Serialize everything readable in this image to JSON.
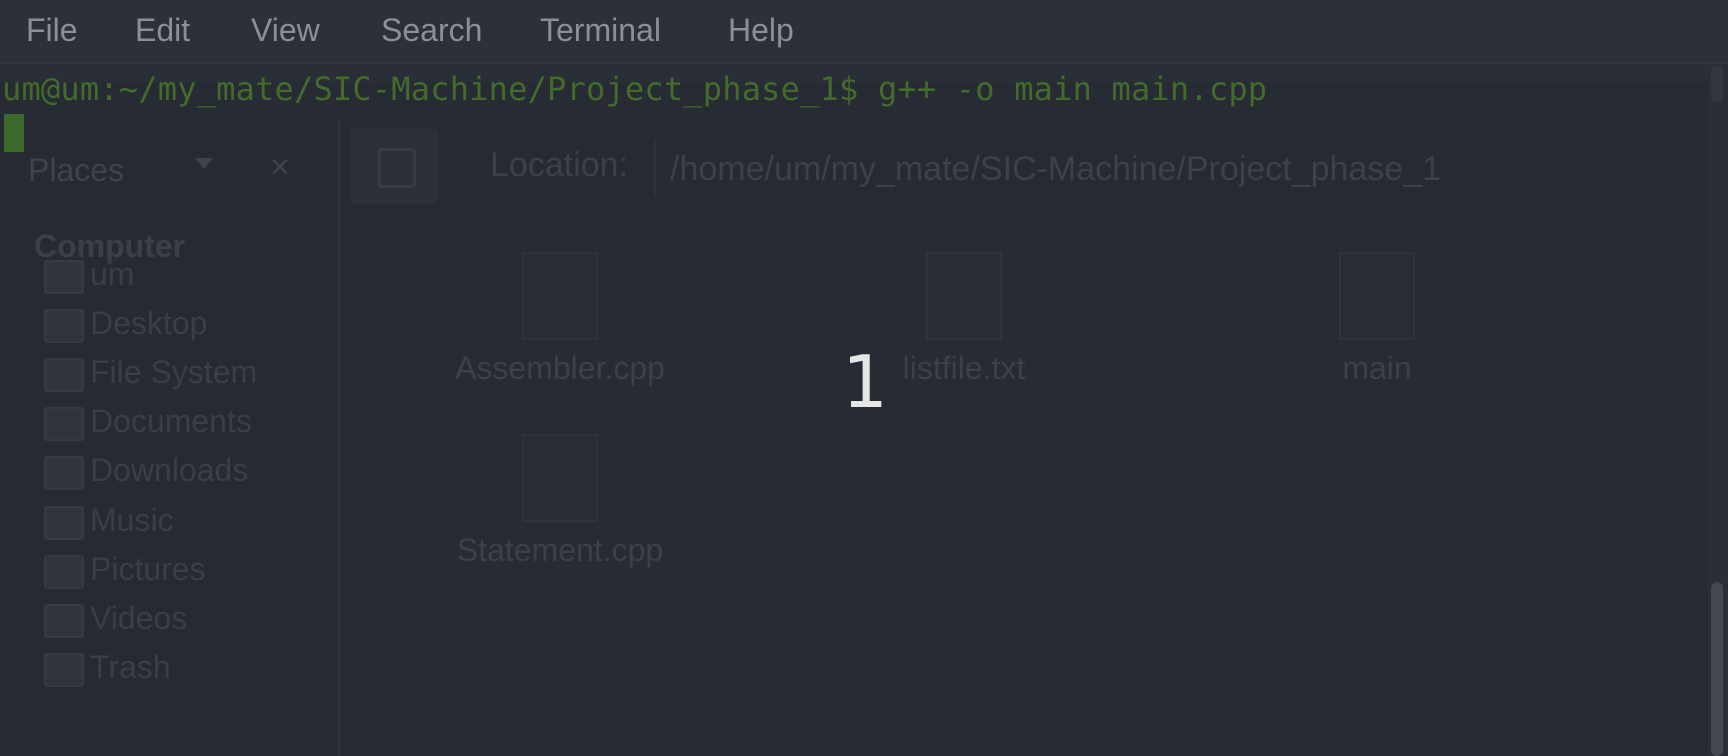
{
  "terminal": {
    "menu": [
      "File",
      "Edit",
      "View",
      "Search",
      "Terminal",
      "Help"
    ],
    "prompt_line": "um@um:~/my_mate/SIC-Machine/Project_phase_1$ g++ -o main main.cpp",
    "colors": {
      "prompt": "#426b2c",
      "background": "#272b33",
      "menu_text": "#8a8f98"
    }
  },
  "file_manager": {
    "places_label": "Places",
    "location_label": "Location:",
    "location_value": "/home/um/my_mate/SIC-Machine/Project_phase_1",
    "sidebar_heading": "Computer",
    "sidebar_items": [
      {
        "label": "um",
        "icon": "folder-home-icon"
      },
      {
        "label": "Desktop",
        "icon": "folder-icon"
      },
      {
        "label": "File System",
        "icon": "drive-icon"
      },
      {
        "label": "Documents",
        "icon": "folder-icon"
      },
      {
        "label": "Downloads",
        "icon": "folder-icon"
      },
      {
        "label": "Music",
        "icon": "folder-icon"
      },
      {
        "label": "Pictures",
        "icon": "folder-icon"
      },
      {
        "label": "Videos",
        "icon": "folder-icon"
      },
      {
        "label": "Trash",
        "icon": "trash-icon"
      }
    ],
    "files": [
      "Assembler.cpp",
      "listfile.txt",
      "main",
      "Statement.cpp"
    ]
  },
  "overlay": {
    "step_number": "1"
  }
}
